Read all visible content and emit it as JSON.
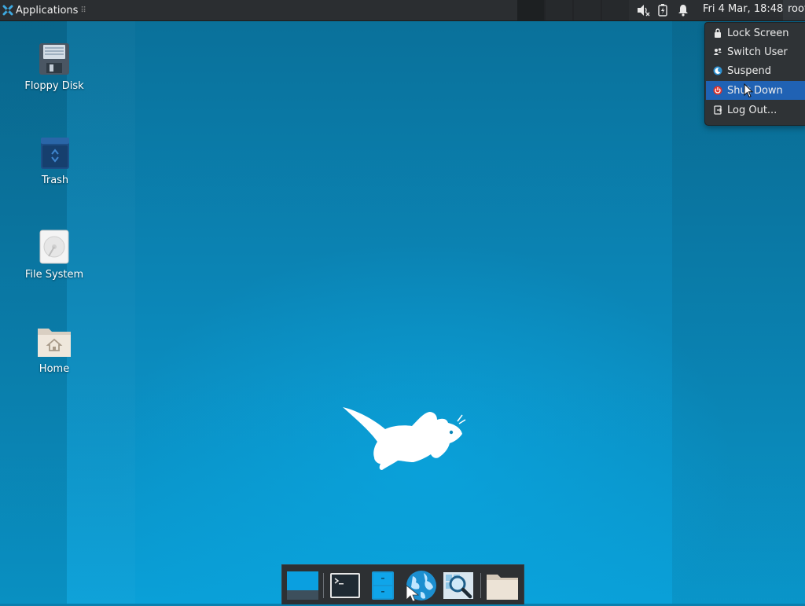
{
  "top_panel": {
    "applications_label": "Applications",
    "clock": "Fri  4 Mar, 18:48",
    "user": "root",
    "tray_icons": [
      "volume-muted-icon",
      "battery-icon",
      "notification-bell-icon"
    ]
  },
  "desktop_icons": [
    {
      "label": "Floppy Disk",
      "icon": "floppy-disk-icon"
    },
    {
      "label": "Trash",
      "icon": "trash-icon"
    },
    {
      "label": "File System",
      "icon": "hard-drive-icon"
    },
    {
      "label": "Home",
      "icon": "home-folder-icon"
    }
  ],
  "session_menu": {
    "items": [
      {
        "label": "Lock Screen",
        "icon": "lock-icon"
      },
      {
        "label": "Switch User",
        "icon": "switch-user-icon"
      },
      {
        "label": "Suspend",
        "icon": "suspend-icon"
      },
      {
        "label": "Shut Down",
        "icon": "power-icon",
        "highlighted": true
      },
      {
        "label": "Log Out...",
        "icon": "logout-icon"
      }
    ]
  },
  "dock": {
    "items": [
      "show-desktop",
      "terminal",
      "file-manager",
      "web-browser",
      "app-finder",
      "home-folder"
    ]
  },
  "colors": {
    "accent": "#2062b4",
    "panel": "#2b2e31",
    "desktop": "#0a8fc4"
  }
}
